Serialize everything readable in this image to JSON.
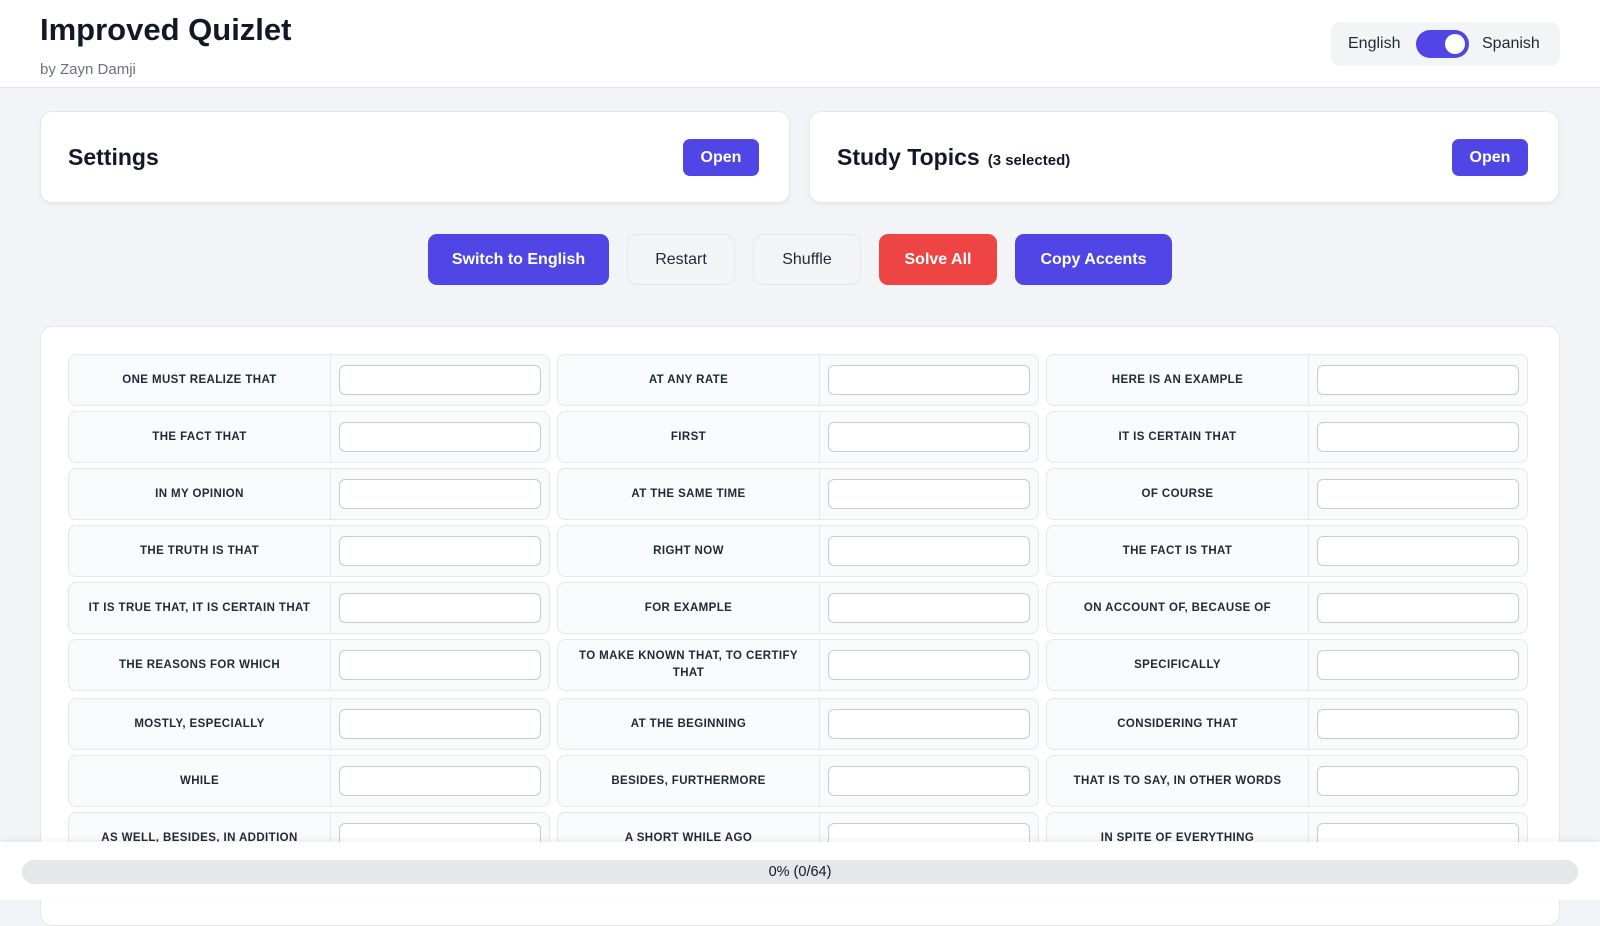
{
  "header": {
    "title": "Improved Quizlet",
    "subtitle": "by Zayn Damji",
    "toggle": {
      "left_label": "English",
      "right_label": "Spanish",
      "state": "Spanish"
    }
  },
  "settings_card": {
    "title": "Settings",
    "button_label": "Open"
  },
  "topics_card": {
    "title": "Study Topics",
    "count_label": "(3 selected)",
    "button_label": "Open"
  },
  "actions": {
    "switch_label": "Switch to English",
    "restart_label": "Restart",
    "shuffle_label": "Shuffle",
    "solve_label": "Solve All",
    "copy_label": "Copy Accents"
  },
  "colors": {
    "accent": "#4f46e5",
    "danger": "#ef4444"
  },
  "terms": [
    [
      "ONE MUST REALIZE THAT",
      "AT ANY RATE",
      "HERE IS AN EXAMPLE"
    ],
    [
      "THE FACT THAT",
      "FIRST",
      "IT IS CERTAIN THAT"
    ],
    [
      "IN MY OPINION",
      "AT THE SAME TIME",
      "OF COURSE"
    ],
    [
      "THE TRUTH IS THAT",
      "RIGHT NOW",
      "THE FACT IS THAT"
    ],
    [
      "IT IS TRUE THAT, IT IS CERTAIN THAT",
      "FOR EXAMPLE",
      "ON ACCOUNT OF, BECAUSE OF"
    ],
    [
      "THE REASONS FOR WHICH",
      "TO MAKE KNOWN THAT, TO CERTIFY THAT",
      "SPECIFICALLY"
    ],
    [
      "MOSTLY, ESPECIALLY",
      "AT THE BEGINNING",
      "CONSIDERING THAT"
    ],
    [
      "WHILE",
      "BESIDES, FURTHERMORE",
      "THAT IS TO SAY, IN OTHER WORDS"
    ],
    [
      "AS WELL, BESIDES, IN ADDITION",
      "A SHORT WHILE AGO",
      "IN SPITE OF EVERYTHING"
    ]
  ],
  "progress": {
    "fraction": 0,
    "label": "0% (0/64)"
  }
}
